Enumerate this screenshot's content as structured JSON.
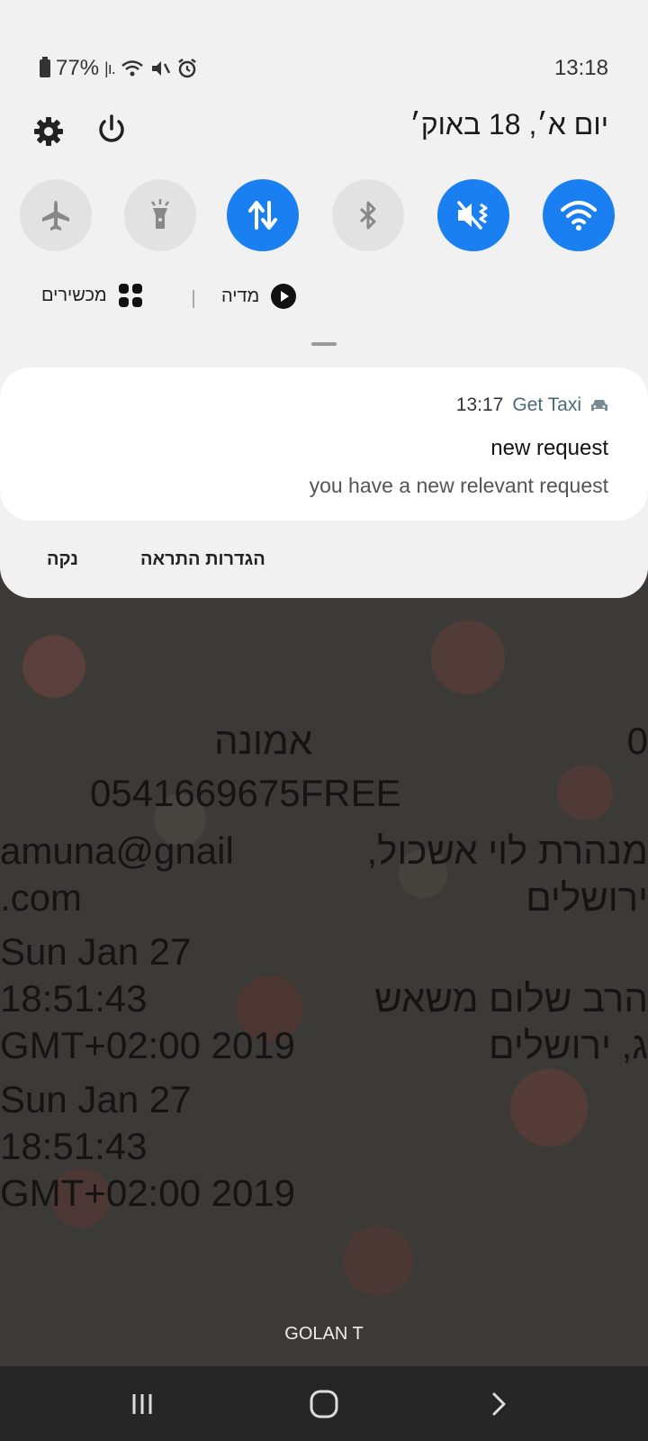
{
  "status_bar": {
    "battery": "77%",
    "time": "13:18"
  },
  "header": {
    "date": "יום א׳, 18 באוק׳"
  },
  "quick_settings": {
    "toggles": [
      {
        "name": "airplane",
        "state": "off"
      },
      {
        "name": "flashlight",
        "state": "off"
      },
      {
        "name": "mobile-data",
        "state": "on"
      },
      {
        "name": "bluetooth",
        "state": "off"
      },
      {
        "name": "mute",
        "state": "on"
      },
      {
        "name": "wifi",
        "state": "on"
      }
    ],
    "media_label": "מדיה",
    "devices_label": "מכשירים",
    "accent": "#1a80f2"
  },
  "notification": {
    "app": "Get Taxi",
    "time": "13:17",
    "title": "new request",
    "body": "you have a new relevant request",
    "actions": {
      "settings": "הגדרות התראה",
      "clear": "נקה"
    }
  },
  "background_app": {
    "lines": [
      {
        "left": "0",
        "right": "אמונה"
      },
      {
        "center": "0541669675FREE"
      },
      {
        "left": "amuna@gnail",
        "right": "מנהרת לוי אשכול,"
      },
      {
        "left": ".com",
        "right": "ירושלים"
      },
      {
        "left": "Sun Jan 27"
      },
      {
        "left": "18:51:43",
        "right": "הרב שלום משאש"
      },
      {
        "left": "GMT+02:00 2019",
        "right": "ג, ירושלים"
      },
      {
        "left": "Sun Jan 27"
      },
      {
        "left": "18:51:43"
      },
      {
        "left": "GMT+02:00 2019"
      }
    ]
  },
  "carrier": "GOLAN T"
}
